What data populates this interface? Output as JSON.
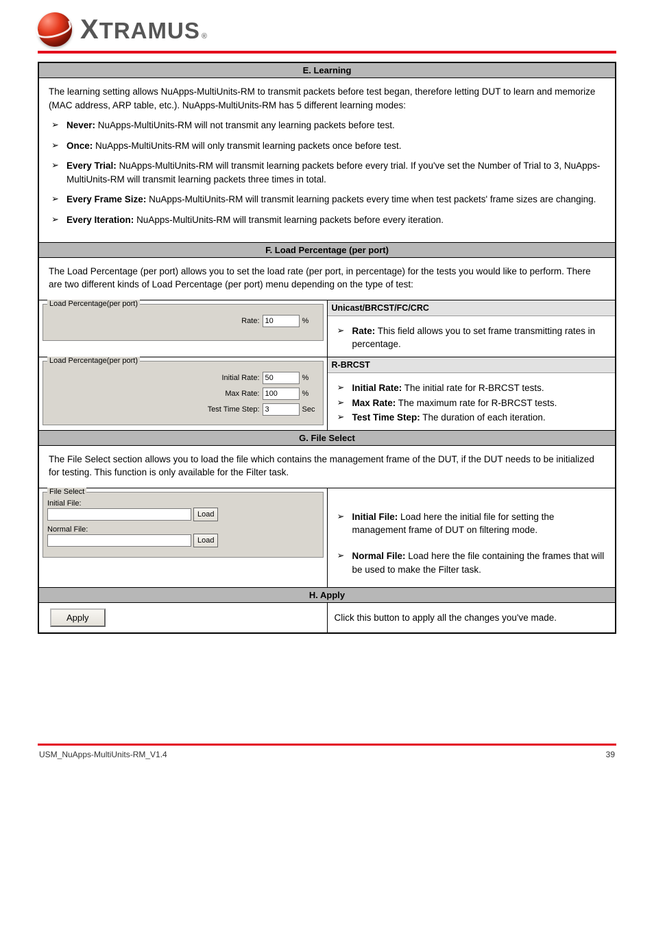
{
  "brand": {
    "name": "XTRAMUS",
    "reg": "®"
  },
  "section1": {
    "title": "E. Learning",
    "intro": "The learning setting allows NuApps-MultiUnits-RM to transmit packets before test began, therefore letting DUT to learn and memorize (MAC address, ARP table, etc.). NuApps-MultiUnits-RM has 5 different learning modes:",
    "items": [
      {
        "label": "Never:",
        "text": "NuApps-MultiUnits-RM will not transmit any learning packets before test."
      },
      {
        "label": "Once:",
        "text": "NuApps-MultiUnits-RM will only transmit learning packets once before test."
      },
      {
        "label": "Every Trial:",
        "text": "NuApps-MultiUnits-RM will transmit learning packets before every trial. If you've set the Number of Trial to 3, NuApps-MultiUnits-RM will transmit learning packets three times in total."
      },
      {
        "label": "Every Frame Size:",
        "text": "NuApps-MultiUnits-RM will transmit learning packets every time when test packets' frame sizes are changing."
      },
      {
        "label": "Every Iteration:",
        "text": "NuApps-MultiUnits-RM will transmit learning packets before every iteration."
      }
    ]
  },
  "section2": {
    "title": "F. Load Percentage (per port)",
    "topText": "The Load Percentage (per port) allows you to set the load rate (per port, in percentage) for the tests you would like to perform. There are two different kinds of Load Percentage (per port) menu depending on the type of test:",
    "panelA": {
      "legend": "Load Percentage(per port)",
      "rate_label": "Rate:",
      "rate_value": "10",
      "rate_suffix": "%"
    },
    "descA": {
      "heading": "Unicast/BRCST/FC/CRC",
      "items": [
        {
          "label": "Rate:",
          "text": "This field allows you to set frame transmitting rates in percentage."
        }
      ]
    },
    "panelB": {
      "legend": "Load Percentage(per port)",
      "initial_label": "Initial Rate:",
      "initial_value": "50",
      "max_label": "Max Rate:",
      "max_value": "100",
      "pct": "%",
      "step_label": "Test Time Step:",
      "step_value": "3",
      "step_suffix": "Sec"
    },
    "descB": {
      "heading": "R-BRCST",
      "items": [
        {
          "label": "Initial Rate:",
          "text": "The initial rate for R-BRCST tests."
        },
        {
          "label": "Max Rate:",
          "text": "The maximum rate for R-BRCST tests."
        },
        {
          "label": "Test Time Step:",
          "text": "The duration of each iteration."
        }
      ]
    }
  },
  "section3": {
    "title": "G. File Select",
    "topText": "The File Select section allows you to load the file which contains the management frame of the DUT, if the DUT needs to be initialized for testing. This function is only available for the Filter task.",
    "panel": {
      "legend": "File Select",
      "initial_label": "Initial File:",
      "normal_label": "Normal File:",
      "load": "Load"
    },
    "items": [
      {
        "label": "Initial File:",
        "text": "Load here the initial file for setting the management frame of DUT on filtering mode."
      },
      {
        "label": "Normal File:",
        "text": "Load here the file containing the frames that will be used to make the Filter task."
      }
    ]
  },
  "section4": {
    "title": "H. Apply",
    "button": "Apply",
    "text": "Click this button to apply all the changes you've made."
  },
  "footer": {
    "left": "USM_NuApps-MultiUnits-RM_V1.4",
    "right": "39"
  }
}
